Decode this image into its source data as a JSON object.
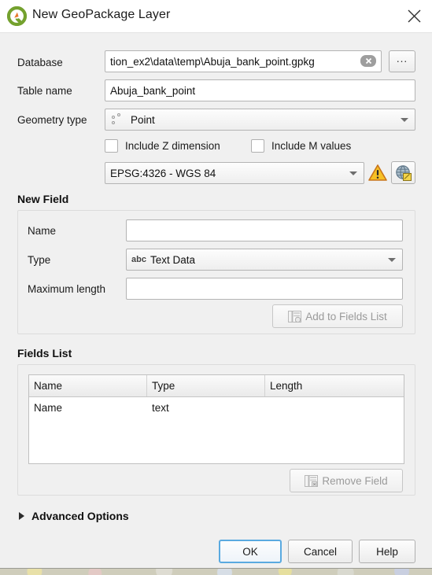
{
  "window": {
    "title": "New GeoPackage Layer",
    "app_icon": "qgis-logo-icon",
    "close_icon": "close-icon"
  },
  "form": {
    "database": {
      "label": "Database",
      "value": "tion_ex2\\data\\temp\\Abuja_bank_point.gpkg",
      "clear_icon": "clear-icon",
      "browse_label": "..."
    },
    "table_name": {
      "label": "Table name",
      "value": "Abuja_bank_point"
    },
    "geometry_type": {
      "label": "Geometry type",
      "value": "Point",
      "icon": "point-geometry-icon"
    },
    "include_z": {
      "label": "Include Z dimension",
      "checked": false
    },
    "include_m": {
      "label": "Include M values",
      "checked": false
    },
    "crs": {
      "value": "EPSG:4326 - WGS 84",
      "warning_icon": "warning-icon",
      "select_crs_icon": "select-crs-globe-icon"
    }
  },
  "new_field": {
    "group_title": "New Field",
    "name": {
      "label": "Name",
      "value": "",
      "placeholder": ""
    },
    "type": {
      "label": "Type",
      "value": "Text Data",
      "icon": "abc-text-icon"
    },
    "maximum_length": {
      "label": "Maximum length",
      "value": "",
      "placeholder": ""
    },
    "add_button": {
      "label": "Add to Fields List",
      "enabled": false,
      "icon": "add-field-icon"
    }
  },
  "fields_list": {
    "group_title": "Fields List",
    "columns": [
      "Name",
      "Type",
      "Length"
    ],
    "rows": [
      {
        "name": "Name",
        "type": "text",
        "length": ""
      }
    ],
    "remove_button": {
      "label": "Remove Field",
      "enabled": false,
      "icon": "remove-field-icon"
    }
  },
  "advanced_options": {
    "label": "Advanced Options",
    "expanded": false,
    "icon": "chevron-right-icon"
  },
  "footer": {
    "ok": "OK",
    "cancel": "Cancel",
    "help": "Help"
  },
  "colors": {
    "dialog_bg": "#f0f0f0",
    "titlebar_bg": "#ffffff",
    "field_bg": "#ffffff",
    "accent_focus": "#5aaae0",
    "warning": "#f5c518",
    "qgis_green": "#74a12e",
    "qgis_orange": "#e8772e",
    "disabled_text": "#9a9a9a"
  }
}
